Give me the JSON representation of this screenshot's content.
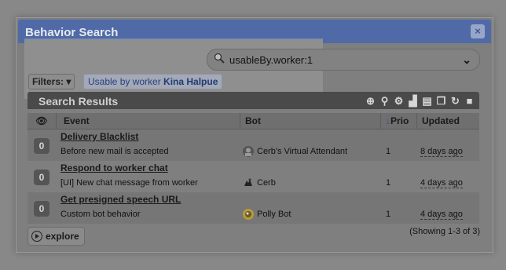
{
  "dialog": {
    "title": "Behavior Search",
    "close_label": "×"
  },
  "search": {
    "query": "usableBy.worker:1",
    "icon": "magnifier-icon",
    "dropdown_icon": "chevron-down-icon"
  },
  "filters": {
    "button_label": "Filters: ▾",
    "chip_prefix": "Usable by worker ",
    "chip_value": "Kina Halpue"
  },
  "results": {
    "title": "Search Results",
    "toolbar_icons": [
      "add-icon",
      "search-icon",
      "gear-icon",
      "chart-icon",
      "export-icon",
      "copy-icon",
      "refresh-icon",
      "select-all-icon"
    ],
    "columns": {
      "watch": "👁",
      "event": "Event",
      "bot": "Bot",
      "sort_icon": "↓",
      "priority": "Prio",
      "updated": "Updated"
    },
    "rows": [
      {
        "count": "0",
        "name": "Delivery Blacklist",
        "event": "Before new mail is accepted",
        "bot": "Cerb's Virtual Attendant",
        "bot_icon": "attendant-avatar",
        "priority": "1",
        "updated": "8 days ago"
      },
      {
        "count": "0",
        "name": "Respond to worker chat",
        "event": "[UI] New chat message from worker",
        "bot": "Cerb",
        "bot_icon": "cerb-avatar",
        "priority": "1",
        "updated": "4 days ago"
      },
      {
        "count": "0",
        "name": "Get presigned speech URL",
        "event": "Custom bot behavior",
        "bot": "Polly Bot",
        "bot_icon": "polly-avatar",
        "priority": "1",
        "updated": "4 days ago"
      }
    ],
    "showing": "(Showing 1-3 of 3)"
  },
  "explore": {
    "label": "explore"
  },
  "colors": {
    "titlebar": "#4f6aa7",
    "overlay": "#7f7f7f",
    "header_bar": "#4a4a4a"
  }
}
